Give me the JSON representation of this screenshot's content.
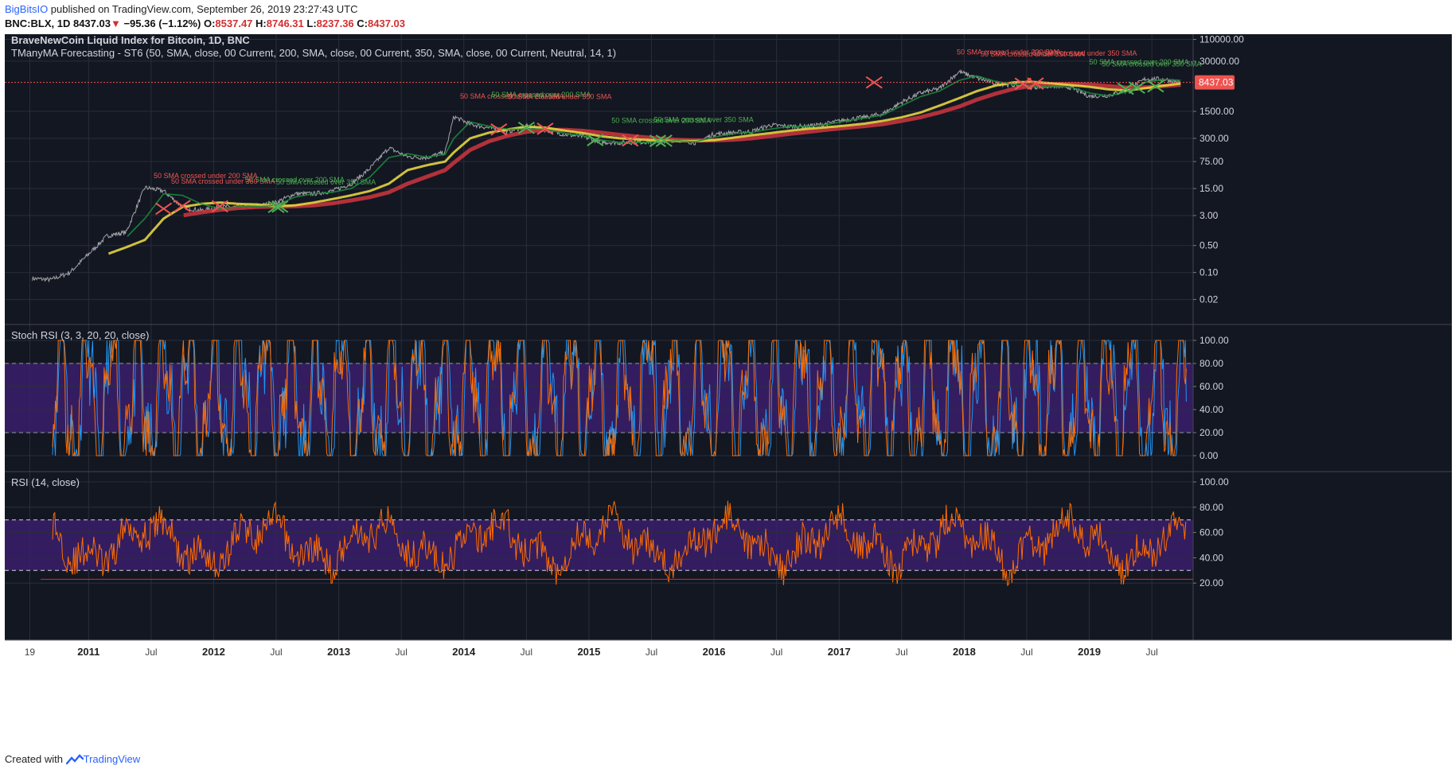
{
  "header": {
    "user": "BigBitsIO",
    "published": " published on TradingView.com, September 26, 2019 23:27:43 UTC",
    "symbol": "BNC:BLX, 1D",
    "last": "8437.03",
    "down_arrow": "▼",
    "change": "−95.36 (−1.12%)",
    "o_label": "O:",
    "o_value": "8537.47",
    "h_label": "H:",
    "h_value": "8746.31",
    "l_label": "L:",
    "l_value": "8237.36",
    "c_label": "C:",
    "c_value": "8437.03"
  },
  "footer": {
    "created": "Created with",
    "brand": "TradingView"
  },
  "colors": {
    "background": "#131722",
    "price": "#c8c8c8",
    "sma50": "#1b8a3a",
    "sma200": "#e0d040",
    "sma350": "#c0343d",
    "stoch_k": "#2196f3",
    "stoch_d": "#ff6d00",
    "rsi": "#ff6d00",
    "band": "#3a1f6b",
    "last_price_tag": "#ef5350"
  },
  "chart_data": [
    {
      "type": "line",
      "panel": "price",
      "title": "BraveNewCoin Liquid Index for Bitcoin, 1D, BNC",
      "subtitle": "TManyMA Forecasting - ST6 (50, SMA, close, 00 Current, 200, SMA, close, 00 Current, 350, SMA, close, 00 Current, Neutral, 14, 1)",
      "y_scale": "log",
      "y_ticks": [
        "110000.00",
        "30000.00",
        "8437.03",
        "1500.00",
        "300.00",
        "75.00",
        "15.00",
        "3.00",
        "0.50",
        "0.10",
        "0.02"
      ],
      "y_tick_values": [
        110000,
        30000,
        1500,
        300,
        75,
        15,
        3,
        0.5,
        0.1,
        0.02
      ],
      "last_price": 8437.03,
      "last_price_label": "8437.03",
      "x": [
        2010.55,
        2010.7,
        2010.85,
        2011.0,
        2011.15,
        2011.3,
        2011.45,
        2011.6,
        2011.75,
        2011.9,
        2012.05,
        2012.2,
        2012.35,
        2012.5,
        2012.65,
        2012.8,
        2012.95,
        2013.1,
        2013.25,
        2013.4,
        2013.55,
        2013.7,
        2013.85,
        2013.92,
        2014.05,
        2014.2,
        2014.35,
        2014.5,
        2014.65,
        2014.8,
        2014.95,
        2015.1,
        2015.25,
        2015.4,
        2015.55,
        2015.7,
        2015.85,
        2016.0,
        2016.15,
        2016.3,
        2016.45,
        2016.6,
        2016.75,
        2016.9,
        2017.05,
        2017.2,
        2017.35,
        2017.5,
        2017.65,
        2017.8,
        2017.96,
        2018.1,
        2018.25,
        2018.4,
        2018.55,
        2018.7,
        2018.85,
        2019.0,
        2019.15,
        2019.3,
        2019.45,
        2019.6,
        2019.73
      ],
      "series": [
        {
          "name": "price",
          "values": [
            0.07,
            0.065,
            0.1,
            0.3,
            0.9,
            1.1,
            16,
            13,
            5,
            4,
            5,
            5,
            5.3,
            6.5,
            11,
            11,
            13,
            20,
            50,
            170,
            100,
            95,
            130,
            1100,
            700,
            560,
            450,
            620,
            500,
            380,
            330,
            240,
            230,
            240,
            250,
            280,
            230,
            390,
            420,
            450,
            660,
            610,
            620,
            720,
            910,
            1050,
            1300,
            2600,
            4500,
            5800,
            16000,
            11000,
            8000,
            7100,
            6400,
            6700,
            6300,
            3700,
            3900,
            5200,
            10500,
            10200,
            8437
          ]
        },
        {
          "name": "50 SMA",
          "values": [
            null,
            null,
            null,
            null,
            null,
            0.8,
            2.5,
            11,
            10,
            6,
            4.5,
            5,
            5.1,
            5.5,
            9,
            11,
            12,
            15,
            30,
            95,
            120,
            98,
            115,
            300,
            800,
            620,
            520,
            520,
            520,
            410,
            350,
            270,
            235,
            235,
            240,
            260,
            245,
            320,
            400,
            430,
            520,
            610,
            615,
            680,
            840,
            1000,
            1200,
            2100,
            3600,
            5000,
            9500,
            12500,
            9000,
            7500,
            6700,
            6500,
            6400,
            4500,
            3800,
            4800,
            8500,
            10100,
            9600
          ]
        },
        {
          "name": "200 SMA",
          "values": [
            null,
            null,
            null,
            null,
            0.3,
            0.45,
            0.7,
            2.5,
            5,
            6,
            6.5,
            6,
            5.8,
            5.2,
            5.5,
            6.5,
            8,
            10,
            13,
            20,
            45,
            60,
            75,
            130,
            300,
            420,
            510,
            600,
            570,
            480,
            410,
            340,
            300,
            280,
            265,
            255,
            255,
            270,
            310,
            360,
            410,
            470,
            530,
            580,
            640,
            720,
            850,
            1050,
            1400,
            2100,
            3300,
            5000,
            7000,
            8500,
            8700,
            8000,
            7200,
            6500,
            5600,
            5200,
            6000,
            7000,
            7900
          ]
        },
        {
          "name": "350 SMA",
          "values": [
            null,
            null,
            null,
            null,
            null,
            null,
            null,
            null,
            3.0,
            3.6,
            4.2,
            4.7,
            5.0,
            5.1,
            5.2,
            5.5,
            6.2,
            7.4,
            9.0,
            12,
            20,
            30,
            45,
            70,
            150,
            250,
            350,
            440,
            500,
            500,
            470,
            420,
            370,
            330,
            300,
            275,
            265,
            265,
            275,
            300,
            340,
            390,
            440,
            500,
            560,
            620,
            700,
            850,
            1050,
            1400,
            2000,
            3000,
            4300,
            5800,
            7000,
            7600,
            7700,
            7400,
            6800,
            6200,
            6300,
            6800,
            7300
          ]
        }
      ],
      "annotations": [
        {
          "text": "50 SMA crossed under 200 SMA",
          "x": 2011.52,
          "y": 28,
          "color": "#ef5350"
        },
        {
          "text": "50 SMA crossed under 350 SMA",
          "x": 2011.66,
          "y": 20,
          "color": "#ef5350"
        },
        {
          "text": "50 SMA crossed over 200 SMA",
          "x": 2012.25,
          "y": 22,
          "color": "#4caf50"
        },
        {
          "text": "50 SMA crossed over 350 SMA",
          "x": 2012.5,
          "y": 19,
          "color": "#4caf50"
        },
        {
          "text": "50 SMA crossed under 200 SMA",
          "x": 2013.97,
          "y": 3200,
          "color": "#ef5350"
        },
        {
          "text": "50 SMA crossed over 200 SMA",
          "x": 2014.22,
          "y": 3500,
          "color": "#4caf50"
        },
        {
          "text": "50 SMA crossed under 350 SMA",
          "x": 2014.35,
          "y": 3100,
          "color": "#ef5350"
        },
        {
          "text": "50 SMA crossed over 200 SMA",
          "x": 2015.18,
          "y": 750,
          "color": "#4caf50"
        },
        {
          "text": "50 SMA crossed over 350 SMA",
          "x": 2015.52,
          "y": 800,
          "color": "#4caf50"
        },
        {
          "text": "50 SMA crossed under 200 SMA",
          "x": 2017.94,
          "y": 45000,
          "color": "#ef5350"
        },
        {
          "text": "50 SMA crossed under 350 SMA",
          "x": 2018.13,
          "y": 40000,
          "color": "#ef5350"
        },
        {
          "text": "50 SMA crossed under 350 SMA",
          "x": 2018.55,
          "y": 42000,
          "color": "#ef5350"
        },
        {
          "text": "50 SMA crossed over 200 SMA",
          "x": 2019.0,
          "y": 25000,
          "color": "#4caf50"
        },
        {
          "text": "50 SMA crossed over 350 SMA",
          "x": 2019.1,
          "y": 22000,
          "color": "#4caf50"
        }
      ],
      "crosses": [
        {
          "x": 2011.6,
          "y": 4.5,
          "kind": "under"
        },
        {
          "x": 2011.75,
          "y": 5.3,
          "kind": "under"
        },
        {
          "x": 2012.05,
          "y": 5.2,
          "kind": "under"
        },
        {
          "x": 2012.5,
          "y": 5.0,
          "kind": "over"
        },
        {
          "x": 2012.53,
          "y": 5.1,
          "kind": "over"
        },
        {
          "x": 2014.28,
          "y": 510,
          "kind": "under"
        },
        {
          "x": 2014.5,
          "y": 560,
          "kind": "over"
        },
        {
          "x": 2014.65,
          "y": 530,
          "kind": "under"
        },
        {
          "x": 2015.05,
          "y": 270,
          "kind": "over"
        },
        {
          "x": 2015.33,
          "y": 265,
          "kind": "under"
        },
        {
          "x": 2015.55,
          "y": 258,
          "kind": "over"
        },
        {
          "x": 2015.6,
          "y": 260,
          "kind": "over"
        },
        {
          "x": 2017.28,
          "y": 8400,
          "kind": "under"
        },
        {
          "x": 2018.47,
          "y": 7800,
          "kind": "under"
        },
        {
          "x": 2018.57,
          "y": 7900,
          "kind": "under"
        },
        {
          "x": 2019.29,
          "y": 5800,
          "kind": "over"
        },
        {
          "x": 2019.38,
          "y": 6200,
          "kind": "over"
        },
        {
          "x": 2019.53,
          "y": 6700,
          "kind": "over"
        }
      ]
    },
    {
      "type": "line",
      "panel": "stoch_rsi",
      "title": "Stoch RSI (3, 3, 20, 20, close)",
      "ylim": [
        0,
        100
      ],
      "y_ticks": [
        "100.00",
        "80.00",
        "60.00",
        "40.00",
        "20.00",
        "0.00"
      ],
      "y_tick_values": [
        100,
        80,
        60,
        40,
        20,
        0
      ],
      "band": [
        20,
        80
      ]
    },
    {
      "type": "line",
      "panel": "rsi",
      "title": "RSI (14, close)",
      "ylim": [
        0,
        100
      ],
      "y_ticks": [
        "100.00",
        "80.00",
        "60.00",
        "40.00",
        "20.00"
      ],
      "y_tick_values": [
        100,
        80,
        60,
        40,
        20
      ],
      "band": [
        30,
        70
      ]
    }
  ],
  "x_axis": {
    "labels": [
      {
        "text": "19",
        "t": 2010.53,
        "bold": false
      },
      {
        "text": "2011",
        "t": 2011.0,
        "bold": true
      },
      {
        "text": "Jul",
        "t": 2011.5,
        "bold": false
      },
      {
        "text": "2012",
        "t": 2012.0,
        "bold": true
      },
      {
        "text": "Jul",
        "t": 2012.5,
        "bold": false
      },
      {
        "text": "2013",
        "t": 2013.0,
        "bold": true
      },
      {
        "text": "Jul",
        "t": 2013.5,
        "bold": false
      },
      {
        "text": "2014",
        "t": 2014.0,
        "bold": true
      },
      {
        "text": "Jul",
        "t": 2014.5,
        "bold": false
      },
      {
        "text": "2015",
        "t": 2015.0,
        "bold": true
      },
      {
        "text": "Jul",
        "t": 2015.5,
        "bold": false
      },
      {
        "text": "2016",
        "t": 2016.0,
        "bold": true
      },
      {
        "text": "Jul",
        "t": 2016.5,
        "bold": false
      },
      {
        "text": "2017",
        "t": 2017.0,
        "bold": true
      },
      {
        "text": "Jul",
        "t": 2017.5,
        "bold": false
      },
      {
        "text": "2018",
        "t": 2018.0,
        "bold": true
      },
      {
        "text": "Jul",
        "t": 2018.5,
        "bold": false
      },
      {
        "text": "2019",
        "t": 2019.0,
        "bold": true
      },
      {
        "text": "Jul",
        "t": 2019.5,
        "bold": false
      }
    ]
  }
}
